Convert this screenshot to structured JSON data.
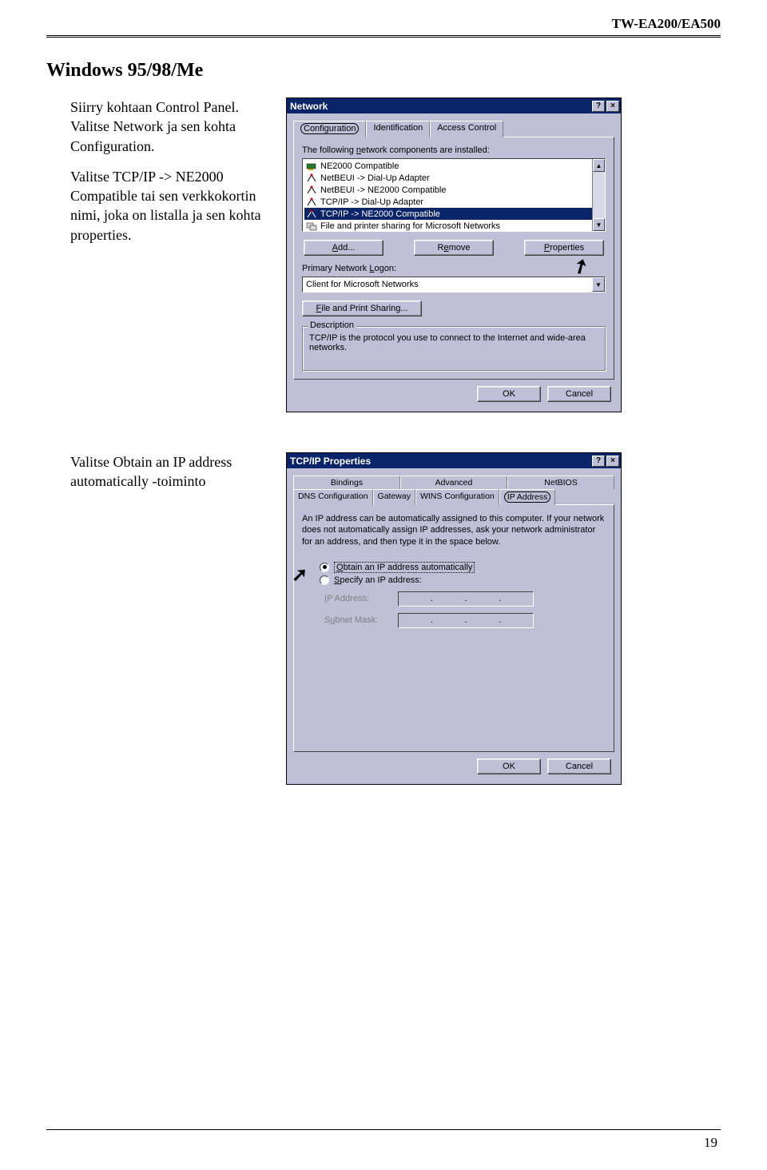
{
  "header": {
    "doc_id": "TW-EA200/EA500"
  },
  "section_title": "Windows 95/98/Me",
  "instructions": {
    "p1": "Siirry kohtaan Control Panel. Valitse Network ja sen kohta Configuration.",
    "p2": "Valitse TCP/IP -> NE2000 Compatible tai sen verkkokortin nimi, joka on listalla ja sen kohta properties.",
    "p3": "Valitse Obtain an IP address automatically -toiminto"
  },
  "dlg1": {
    "title": "Network",
    "help_btn": "?",
    "close_btn": "×",
    "tabs": {
      "config": "Configuration",
      "ident": "Identification",
      "access": "Access Control"
    },
    "list_label": "The following network components are installed:",
    "items": {
      "i0": "NE2000 Compatible",
      "i1": "NetBEUI -> Dial-Up Adapter",
      "i2": "NetBEUI -> NE2000 Compatible",
      "i3": "TCP/IP -> Dial-Up Adapter",
      "i4": "TCP/IP -> NE2000 Compatible",
      "i5": "File and printer sharing for Microsoft Networks"
    },
    "buttons": {
      "add": "Add...",
      "remove": "Remove",
      "props": "Properties"
    },
    "logon_label": "Primary Network Logon:",
    "logon_value": "Client for Microsoft Networks",
    "fps": "File and Print Sharing...",
    "desc_legend": "Description",
    "desc_text": "TCP/IP is the protocol you use to connect to the Internet and wide-area networks.",
    "ok": "OK",
    "cancel": "Cancel"
  },
  "dlg2": {
    "title": "TCP/IP Properties",
    "help_btn": "?",
    "close_btn": "×",
    "tabs_row1": {
      "bind": "Bindings",
      "adv": "Advanced",
      "nbios": "NetBIOS"
    },
    "tabs_row2": {
      "dns": "DNS Configuration",
      "gw": "Gateway",
      "wins": "WINS Configuration",
      "ip": "IP Address"
    },
    "body_text": "An IP address can be automatically assigned to this computer. If your network does not automatically assign IP addresses, ask your network administrator for an address, and then type it in the space below.",
    "radio1": "Obtain an IP address automatically",
    "radio2": "Specify an IP address:",
    "ip_label": "IP Address:",
    "mask_label": "Subnet Mask:",
    "dot": ".",
    "ok": "OK",
    "cancel": "Cancel"
  },
  "page_number": "19"
}
